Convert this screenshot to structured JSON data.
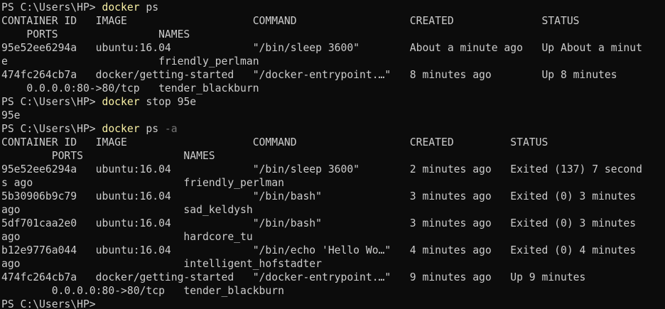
{
  "colors": {
    "background": "#0c0c0c",
    "foreground": "#cccccc",
    "command": "#f9f1a5",
    "flag": "#767676"
  },
  "lines": [
    {
      "type": "prompt",
      "prompt": "PS C:\\Users\\HP> ",
      "command": "docker",
      "args": " ps",
      "flag": ""
    },
    {
      "type": "output",
      "text": "CONTAINER ID   IMAGE                    COMMAND                  CREATED              STATUS"
    },
    {
      "type": "output",
      "text": "    PORTS                NAMES"
    },
    {
      "type": "output",
      "text": "95e52ee6294a   ubuntu:16.04             \"/bin/sleep 3600\"        About a minute ago   Up About a minut"
    },
    {
      "type": "output",
      "text": "e                        friendly_perlman"
    },
    {
      "type": "output",
      "text": "474fc264cb7a   docker/getting-started   \"/docker-entrypoint.…\"   8 minutes ago        Up 8 minutes"
    },
    {
      "type": "output",
      "text": "    0.0.0.0:80->80/tcp   tender_blackburn"
    },
    {
      "type": "prompt",
      "prompt": "PS C:\\Users\\HP> ",
      "command": "docker",
      "args": " stop 95e",
      "flag": ""
    },
    {
      "type": "output",
      "text": "95e"
    },
    {
      "type": "prompt",
      "prompt": "PS C:\\Users\\HP> ",
      "command": "docker",
      "args": " ps ",
      "flag": "-a"
    },
    {
      "type": "output",
      "text": "CONTAINER ID   IMAGE                    COMMAND                  CREATED         STATUS"
    },
    {
      "type": "output",
      "text": "        PORTS                NAMES"
    },
    {
      "type": "output",
      "text": "95e52ee6294a   ubuntu:16.04             \"/bin/sleep 3600\"        2 minutes ago   Exited (137) 7 second"
    },
    {
      "type": "output",
      "text": "s ago                        friendly_perlman"
    },
    {
      "type": "output",
      "text": "5b30906b9c79   ubuntu:16.04             \"/bin/bash\"              3 minutes ago   Exited (0) 3 minutes"
    },
    {
      "type": "output",
      "text": "ago                          sad_keldysh"
    },
    {
      "type": "output",
      "text": "5df701caa2e0   ubuntu:16.04             \"/bin/bash\"              3 minutes ago   Exited (0) 3 minutes"
    },
    {
      "type": "output",
      "text": "ago                          hardcore_tu"
    },
    {
      "type": "output",
      "text": "b12e9776a044   ubuntu:16.04             \"/bin/echo 'Hello Wo…\"   4 minutes ago   Exited (0) 4 minutes"
    },
    {
      "type": "output",
      "text": "ago                          intelligent_hofstadter"
    },
    {
      "type": "output",
      "text": "474fc264cb7a   docker/getting-started   \"/docker-entrypoint.…\"   9 minutes ago   Up 9 minutes"
    },
    {
      "type": "output",
      "text": "        0.0.0.0:80->80/tcp   tender_blackburn"
    },
    {
      "type": "prompt",
      "prompt": "PS C:\\Users\\HP>",
      "command": "",
      "args": "",
      "flag": ""
    }
  ]
}
